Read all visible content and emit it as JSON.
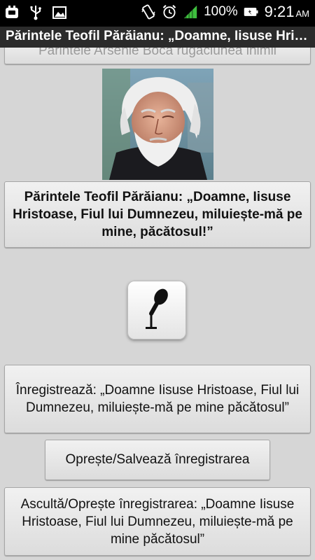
{
  "status_bar": {
    "battery_percent": "100%",
    "time": "9:21",
    "ampm": "AM",
    "icons": [
      "app-notification-icon",
      "usb-icon",
      "image-icon",
      "vibrate-icon",
      "alarm-icon",
      "signal-icon",
      "battery-icon"
    ]
  },
  "titlebar": {
    "title": "Părintele Teofil Părăianu: „Doamne, Iisuse Hristoase, Fiul lui Dumnezeu, miluiește-mă pe mine, păcătosul!”"
  },
  "content": {
    "previous_button_label": "Părintele Arsenie Boca rugăciunea inimii",
    "title_button_label": "Părintele Teofil Părăianu: „Doamne, Iisuse Hristoase, Fiul lui Dumnezeu, miluiește-mă pe mine, păcătosul!”",
    "record_button_label": "Înregistrează: „Doamne Iisuse Hristoase, Fiul lui Dumnezeu, miluiește-mă pe mine păcătosul”",
    "stop_button_label": "Oprește/Salvează înregistrarea",
    "listen_button_label": "Ascultă/Oprește înregistrarea: „Doamne Iisuse Hristoase, Fiul lui Dumnezeu, miluiește-mă pe mine păcătosul”"
  },
  "colors": {
    "status_bar": "#000000",
    "titlebar": "#2b2b2b",
    "background": "#d6d6d6",
    "signal": "#3fbf3f"
  }
}
